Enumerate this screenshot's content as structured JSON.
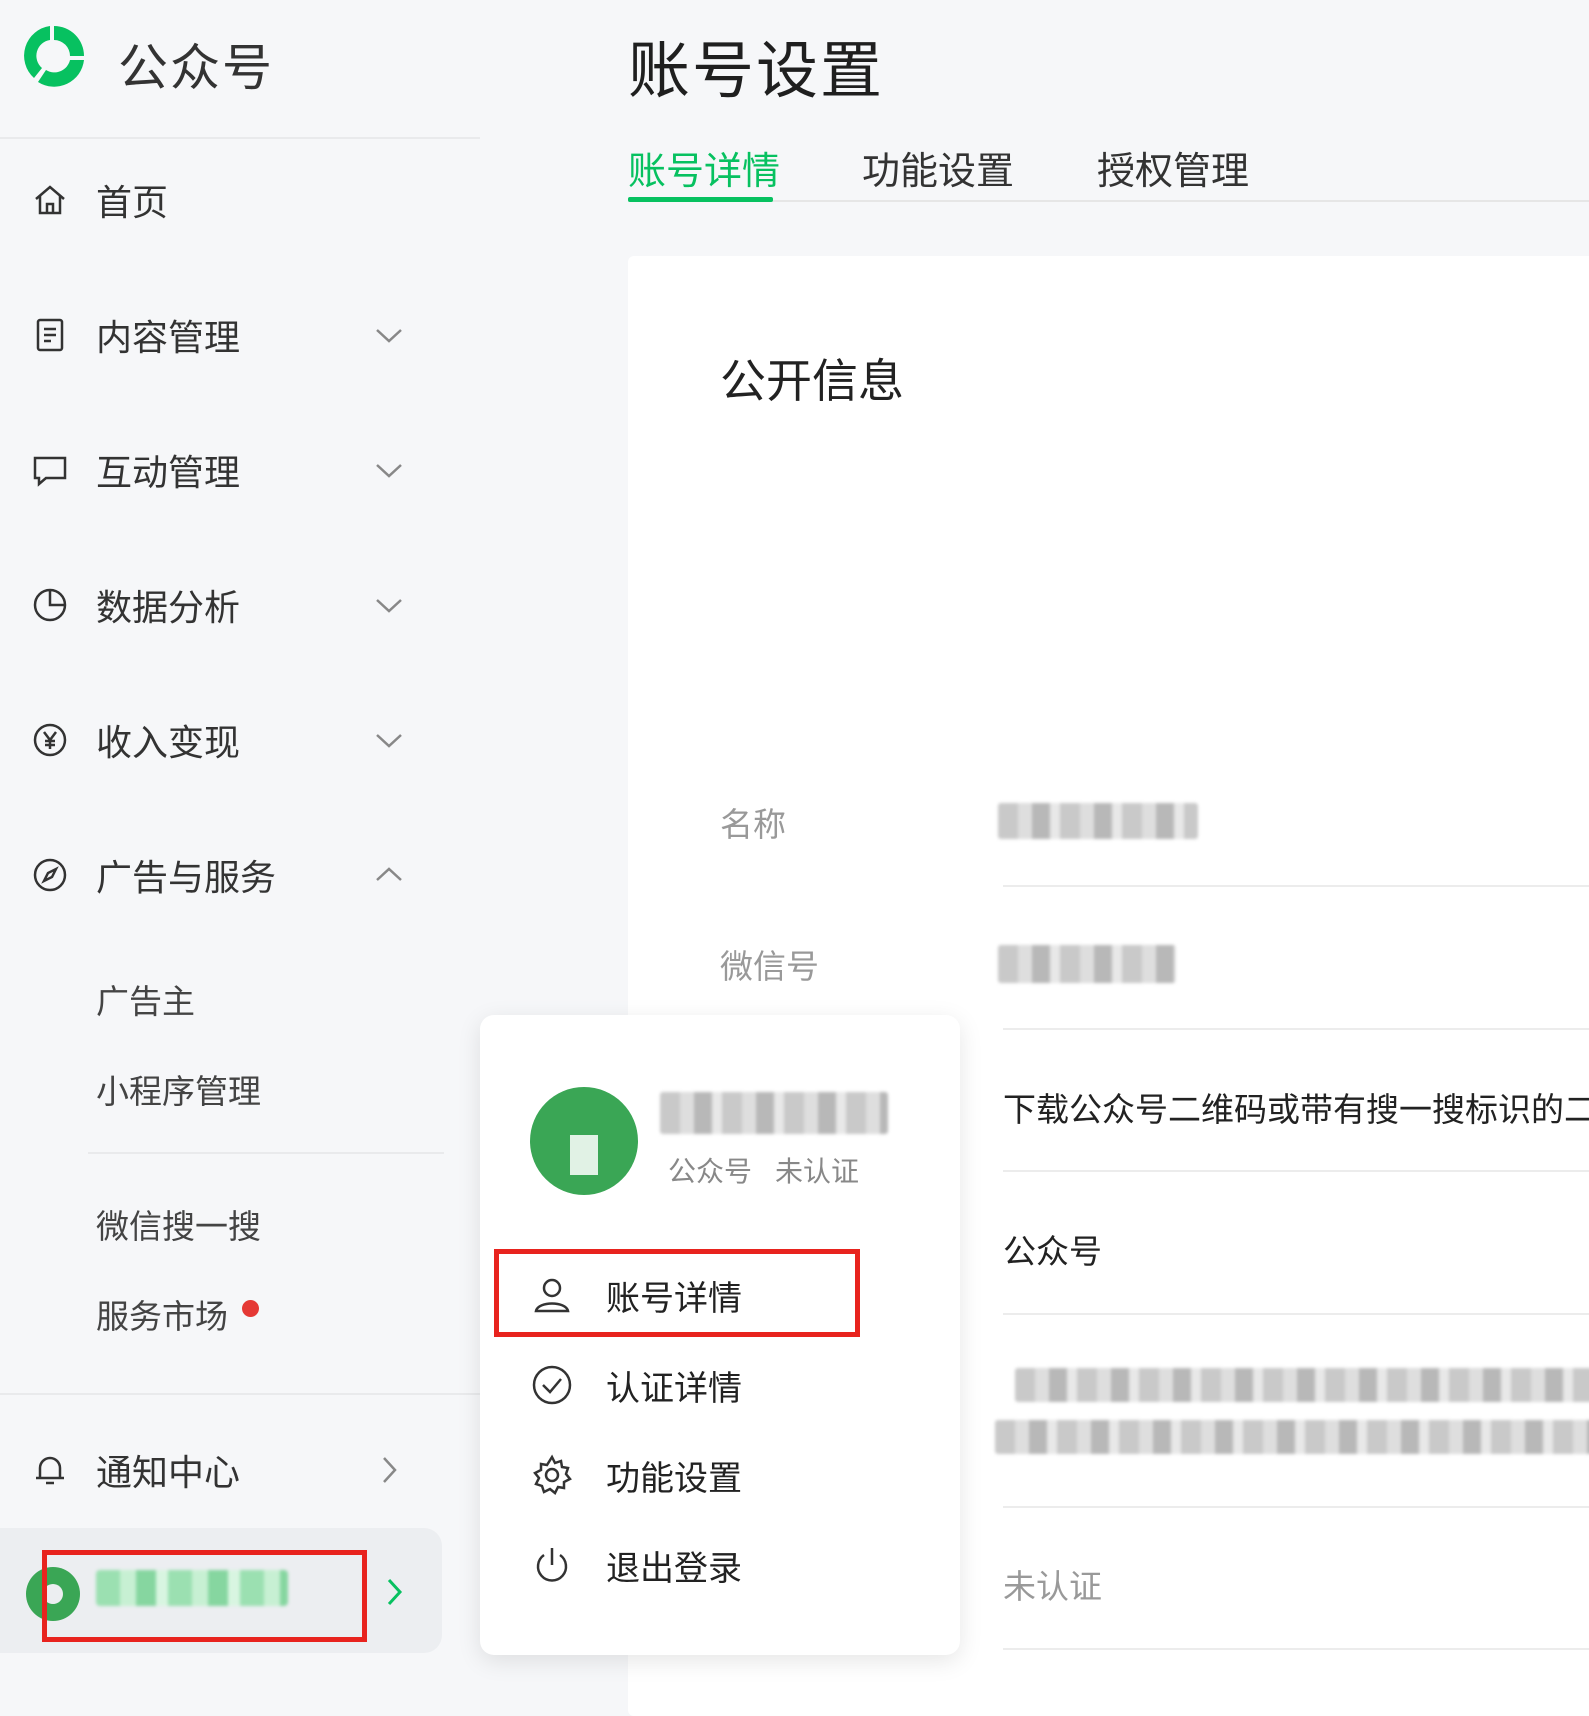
{
  "brand": {
    "name": "公众号"
  },
  "sidebar": {
    "items": [
      {
        "label": "首页",
        "icon": "home-icon"
      },
      {
        "label": "内容管理",
        "icon": "document-icon",
        "chevron": "down"
      },
      {
        "label": "互动管理",
        "icon": "chat-icon",
        "chevron": "down"
      },
      {
        "label": "数据分析",
        "icon": "pie-chart-icon",
        "chevron": "down"
      },
      {
        "label": "收入变现",
        "icon": "yuan-icon",
        "chevron": "down"
      },
      {
        "label": "广告与服务",
        "icon": "compass-icon",
        "chevron": "up"
      }
    ],
    "subitems": [
      "广告主",
      "小程序管理",
      "微信搜一搜",
      "服务市场"
    ],
    "notification": {
      "label": "通知中心",
      "icon": "bell-icon"
    }
  },
  "main": {
    "title": "账号设置",
    "tabs": [
      "账号详情",
      "功能设置",
      "授权管理"
    ],
    "active_tab": 0,
    "section_title": "公开信息",
    "fields": [
      {
        "label": "名称"
      },
      {
        "label": "微信号"
      }
    ],
    "qr_text": "下载公众号二维码或带有搜一搜标识的二维码",
    "type_value": "公众号",
    "verify_value": "未认证"
  },
  "popover": {
    "account_type": "公众号",
    "verify_status": "未认证",
    "menu": [
      {
        "label": "账号详情",
        "icon": "user-icon"
      },
      {
        "label": "认证详情",
        "icon": "check-circle-icon"
      },
      {
        "label": "功能设置",
        "icon": "gear-icon"
      },
      {
        "label": "退出登录",
        "icon": "power-icon"
      }
    ]
  },
  "colors": {
    "accent": "#07c160",
    "highlight": "#e8231e",
    "badge": "#e53935"
  }
}
